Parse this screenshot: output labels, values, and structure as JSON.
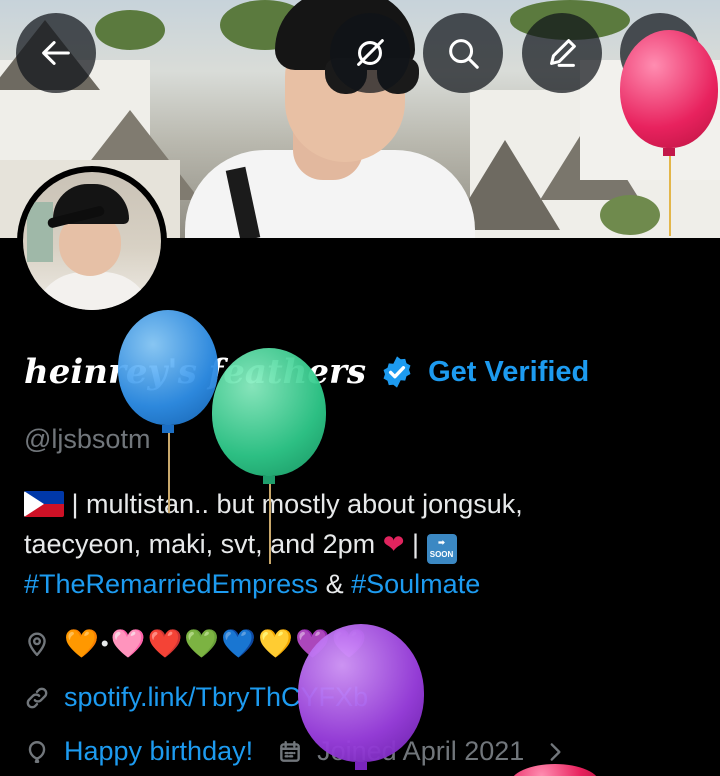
{
  "top_bar": {
    "back_icon": "arrow-left-icon",
    "grok_icon": "grok-icon",
    "search_icon": "search-icon",
    "edit_icon": "edit-icon",
    "more_icon": "more-vertical-icon"
  },
  "profile": {
    "display_name": "heinrey's feathers",
    "get_verified_label": "Get Verified",
    "handle": "@ljsbsotm",
    "bio_line1": " | multistan.. but mostly about jongsuk,",
    "bio_line2_text": "taecyeon, maki, svt, and 2pm",
    "bio_separator": " | ",
    "soon_label": "SOON",
    "hashtag1": "#TheRemarriedEmpress",
    "bio_amp": " & ",
    "hashtag2": "#Soulmate",
    "location_hearts": [
      "🧡",
      "•",
      "🩷",
      "❤️",
      "💚",
      "💙",
      "💛",
      "💜",
      "💜"
    ],
    "website": "spotify.link/TbryThCYFXb",
    "birthday": "Happy birthday!",
    "joined": "Joined April 2021"
  },
  "colors": {
    "accent": "#1d9bf0",
    "background": "#000000",
    "secondary_text": "#71767b",
    "primary_text": "#e7e9ea"
  }
}
